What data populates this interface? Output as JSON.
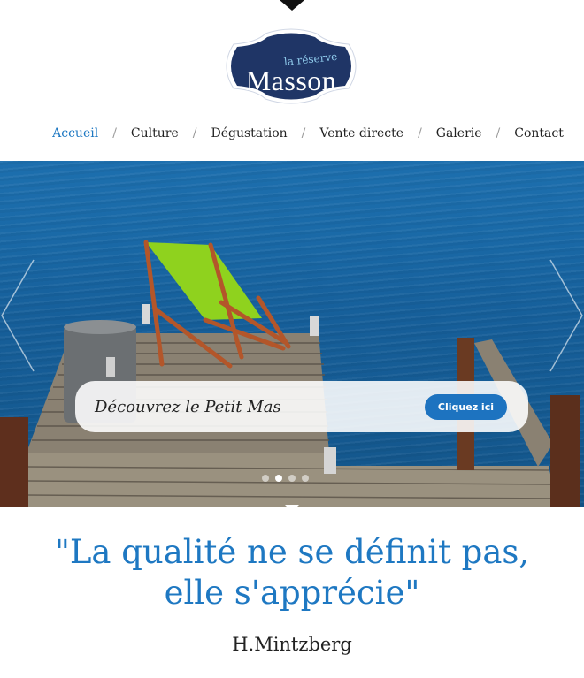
{
  "logo": {
    "small_text": "la réserve",
    "big_text": "Masson"
  },
  "nav": {
    "items": [
      {
        "label": "Accueil",
        "active": true
      },
      {
        "label": "Culture",
        "active": false
      },
      {
        "label": "Dégustation",
        "active": false
      },
      {
        "label": "Vente directe",
        "active": false
      },
      {
        "label": "Galerie",
        "active": false
      },
      {
        "label": "Contact",
        "active": false
      }
    ],
    "separator": "/"
  },
  "hero": {
    "caption": "Découvrez le Petit Mas",
    "button_label": "Cliquez ici",
    "slide_count": 4,
    "active_slide": 2
  },
  "quote": {
    "line1": "\"La qualité ne se définit pas,",
    "line2": "elle s'apprécie\"",
    "author": "H.Mintzberg"
  },
  "colors": {
    "accent": "#1e78c2",
    "logo_bg": "#1f3566",
    "button": "#1d73c0"
  }
}
